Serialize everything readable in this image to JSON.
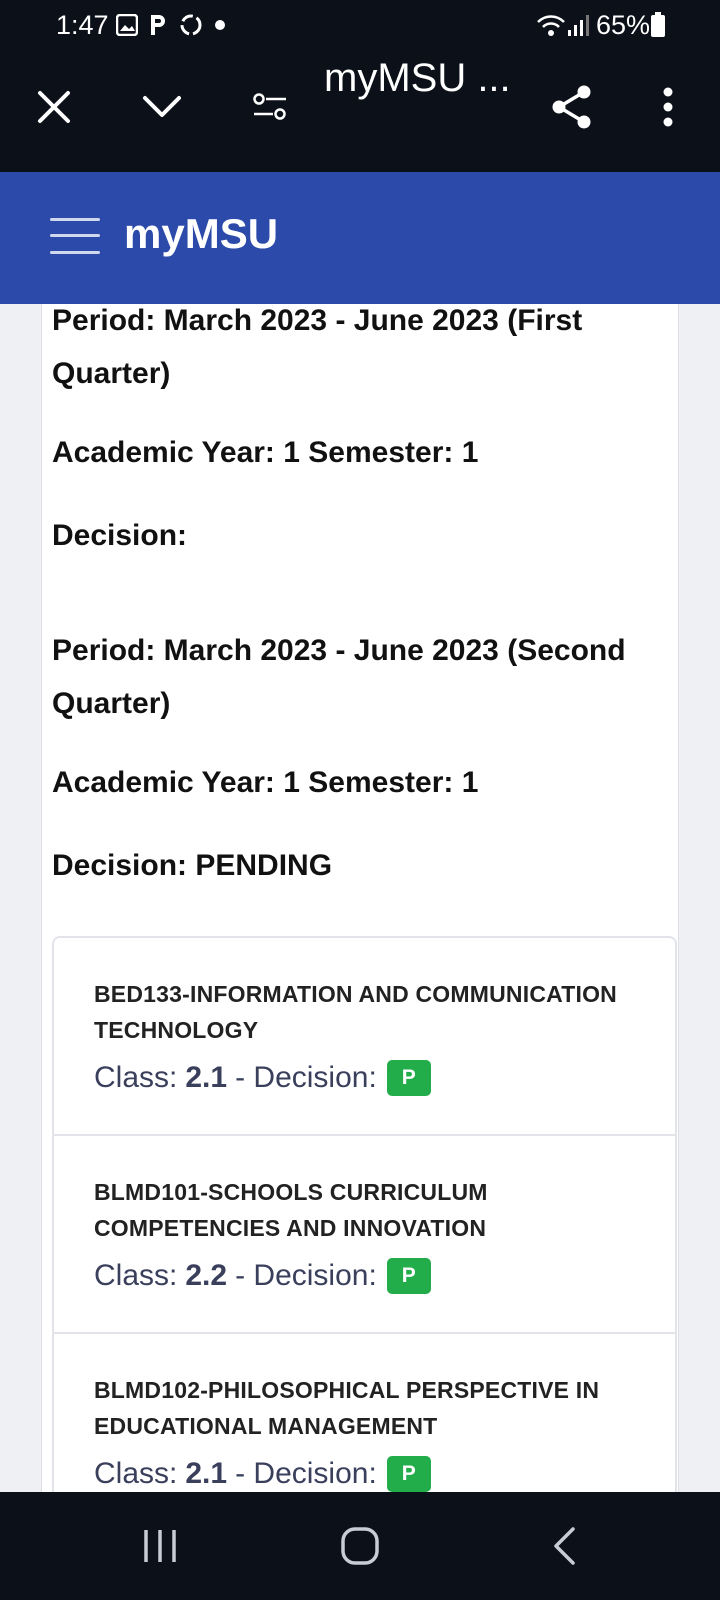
{
  "status_bar": {
    "time": "1:47",
    "battery": "65%"
  },
  "browser": {
    "title": "myMSU ...",
    "icons": [
      "close-icon",
      "chevron-down-icon",
      "tune-icon",
      "share-icon",
      "more-vert-icon"
    ]
  },
  "app": {
    "title": "myMSU"
  },
  "periods": [
    {
      "period": "Period: March 2023 - June 2023 (First Quarter)",
      "year_sem": "Academic Year: 1 Semester: 1",
      "decision": "Decision:"
    },
    {
      "period": "Period: March 2023 - June 2023 (Second Quarter)",
      "year_sem": "Academic Year: 1 Semester: 1",
      "decision": "Decision: PENDING"
    }
  ],
  "courses": [
    {
      "name": "BED133-INFORMATION AND COMMUNICATION TECHNOLOGY",
      "class_label": "Class:",
      "class_value": "2.1",
      "decision_label": "- Decision:",
      "badge": "P"
    },
    {
      "name": "BLMD101-SCHOOLS CURRICULUM COMPETENCIES AND INNOVATION",
      "class_label": "Class:",
      "class_value": "2.2",
      "decision_label": "- Decision:",
      "badge": "P"
    },
    {
      "name": "BLMD102-PHILOSOPHICAL PERSPECTIVE IN EDUCATIONAL MANAGEMENT",
      "class_label": "Class:",
      "class_value": "2.1",
      "decision_label": "- Decision:",
      "badge": "P"
    }
  ],
  "colors": {
    "header": "#2c4aaa",
    "badge": "#22ad4a",
    "chrome": "#0b1019"
  }
}
